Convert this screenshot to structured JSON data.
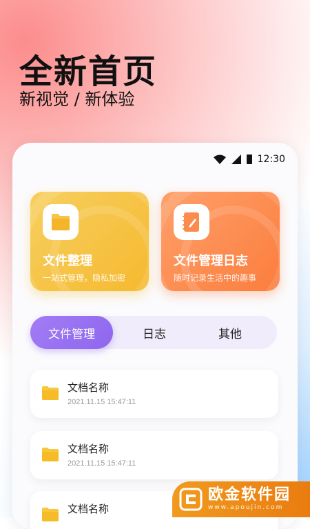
{
  "hero": {
    "title": "全新首页",
    "subtitle": "新视觉 / 新体验"
  },
  "status_bar": {
    "time": "12:30",
    "icons": [
      "wifi-icon",
      "signal-icon",
      "battery-icon"
    ]
  },
  "cards": [
    {
      "title": "文件整理",
      "subtitle": "一站式管理，隐私加密",
      "icon": "folder-icon",
      "color": "#f6c446"
    },
    {
      "title": "文件管理日志",
      "subtitle": "随时记录生活中的趣事",
      "icon": "notebook-icon",
      "color": "#fc8c4e"
    }
  ],
  "tabs": {
    "active_color": "#9b74f3",
    "items": [
      {
        "label": "文件管理",
        "active": true
      },
      {
        "label": "日志",
        "active": false
      },
      {
        "label": "其他",
        "active": false
      }
    ]
  },
  "files": [
    {
      "name": "文档名称",
      "time": "2021.11.15  15:47:11",
      "icon": "folder-icon"
    },
    {
      "name": "文档名称",
      "time": "2021.11.15  15:47:11",
      "icon": "folder-icon"
    },
    {
      "name": "文档名称",
      "time": "",
      "icon": "folder-icon"
    }
  ],
  "watermark": {
    "name": "欧金软件园",
    "url": "www.apoujin.com"
  }
}
